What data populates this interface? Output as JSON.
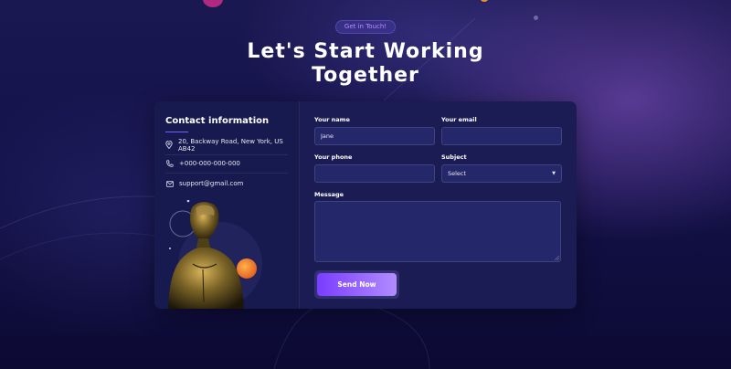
{
  "hero": {
    "badge": "Get in Touch!",
    "title_line1": "Let's Start Working",
    "title_line2": "Together"
  },
  "contact": {
    "title": "Contact information",
    "items": [
      {
        "icon": "location-pin-icon",
        "text": "20, Backway Road, New York, US AB42"
      },
      {
        "icon": "phone-icon",
        "text": "+000-000-000-000"
      },
      {
        "icon": "mail-icon",
        "text": "support@gmail.com"
      }
    ]
  },
  "form": {
    "name_label": "Your name",
    "name_value": "Jane",
    "email_label": "Your email",
    "email_value": "",
    "phone_label": "Your phone",
    "phone_value": "",
    "subject_label": "Subject",
    "subject_selected": "Select",
    "message_label": "Message",
    "message_value": "",
    "submit_label": "Send Now"
  },
  "colors": {
    "accent": "#7a3cff",
    "accent_light": "#b18cff",
    "badge_text": "#b48dff",
    "card_bg": "#1c1c55",
    "page_bg": "#0d0b35"
  }
}
